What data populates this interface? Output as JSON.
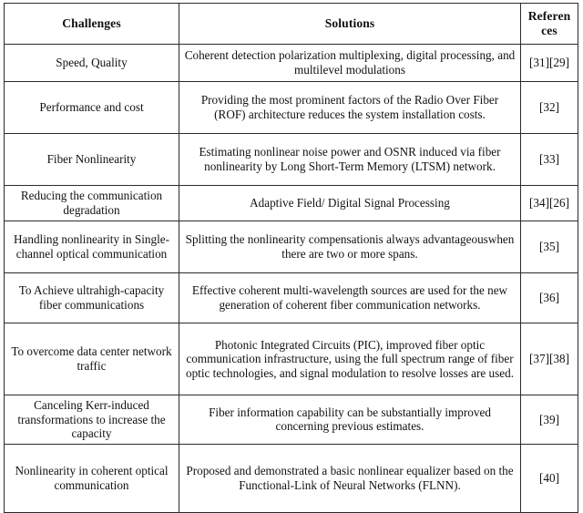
{
  "table": {
    "headers": [
      {
        "label": "Challenges",
        "key": "challenge"
      },
      {
        "label": "Solutions",
        "key": "solution"
      },
      {
        "label": "Referen\nces",
        "key": "reference"
      }
    ],
    "rows": [
      {
        "challenge": "Speed, Quality",
        "solution": "Coherent detection polarization multiplexing, digital processing, and multilevel modulations",
        "reference": "[31][29]"
      },
      {
        "challenge": "Performance and cost",
        "solution": "Providing the most prominent factors of the Radio Over Fiber (ROF) architecture reduces the system installation costs.",
        "reference": "[32]"
      },
      {
        "challenge": "Fiber Nonlinearity",
        "solution": "Estimating nonlinear noise power and OSNR induced via fiber nonlinearity by Long Short-Term Memory (LTSM) network.",
        "reference": "[33]"
      },
      {
        "challenge": "Reducing the communication degradation",
        "solution": "Adaptive Field/ Digital Signal Processing",
        "reference": "[34][26]"
      },
      {
        "challenge": "Handling nonlinearity in Single-channel optical communication",
        "solution": "Splitting the nonlinearity compensationis always advantageouswhen there are two or more spans.",
        "reference": "[35]"
      },
      {
        "challenge": "To Achieve ultrahigh-capacity fiber communications",
        "solution": "Effective coherent multi-wavelength sources are used for the new generation of coherent fiber communication networks.",
        "reference": "[36]"
      },
      {
        "challenge": "To overcome data center network traffic",
        "solution": "Photonic Integrated Circuits (PIC), improved fiber optic communication infrastructure, using the full spectrum range of fiber optic technologies, and signal modulation to resolve losses are used.",
        "reference": "[37][38]"
      },
      {
        "challenge": "Canceling Kerr-induced transformations to increase the capacity",
        "solution": "Fiber information capability can be substantially improved concerning previous estimates.",
        "reference": "[39]"
      },
      {
        "challenge": "Nonlinearity in coherent optical communication",
        "solution": "Proposed and demonstrated a basic nonlinear equalizer based on the Functional-Link of Neural Networks (FLNN).",
        "reference": "[40]"
      }
    ]
  },
  "colors": {
    "border": "#2b2b2b",
    "text": "#111111",
    "background": "#ffffff"
  }
}
